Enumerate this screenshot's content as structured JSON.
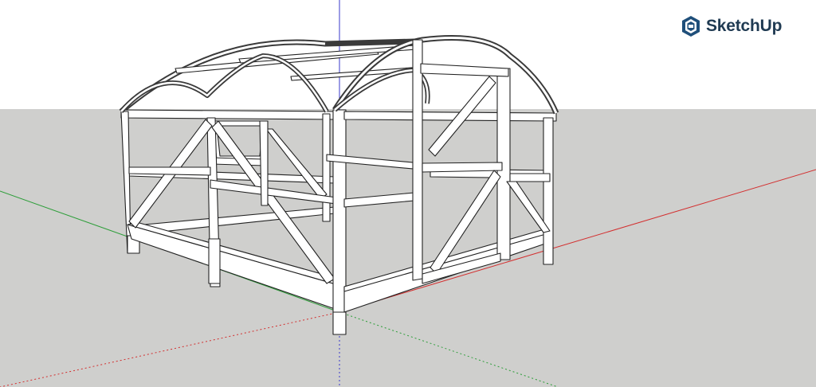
{
  "app": {
    "brand_name": "SketchUp",
    "brand_color": "#1f4f7a",
    "logo_icon": "sketchup-logo-icon"
  },
  "viewport": {
    "sky_color": "#ffffff",
    "ground_color": "#cfcfcd",
    "axes": {
      "red": "#d32f2f",
      "green": "#2e9e3a",
      "blue": "#3a3acb"
    },
    "model": {
      "subject": "timber-frame-hoop-greenhouse",
      "line_color": "#222222",
      "face_color": "#ffffff"
    }
  }
}
